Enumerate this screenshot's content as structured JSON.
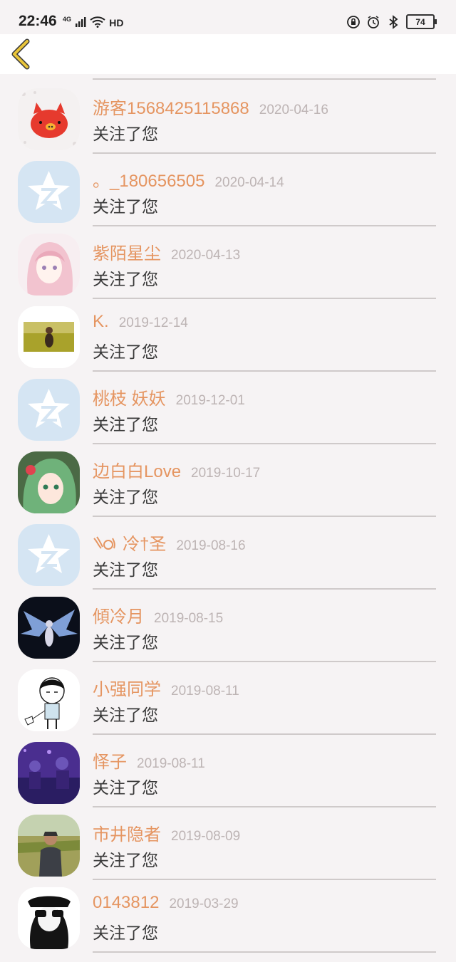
{
  "status": {
    "time": "22:46",
    "network": "4G",
    "hd": "HD",
    "battery": "74"
  },
  "header": {
    "back_icon": "chevron-left-icon",
    "accent_color": "#e9c53a"
  },
  "items": [
    {
      "name": "游客1568425115868",
      "date": "2020-04-16",
      "action": "关注了您",
      "avatar": "red-pig"
    },
    {
      "name": "。_180656505",
      "date": "2020-04-14",
      "action": "关注了您",
      "avatar": "qzone-star"
    },
    {
      "name": "紫陌星尘",
      "date": "2020-04-13",
      "action": "关注了您",
      "avatar": "pink-anime-girl"
    },
    {
      "name": "K.",
      "date": "2019-12-14",
      "action": "关注了您",
      "avatar": "field-photo"
    },
    {
      "name": "桃枝 妖妖",
      "date": "2019-12-01",
      "action": "关注了您",
      "avatar": "qzone-star"
    },
    {
      "name": "边白白Love",
      "date": "2019-10-17",
      "action": "关注了您",
      "avatar": "green-hair-anime"
    },
    {
      "name": "冷†圣",
      "date": "2019-08-16",
      "action": "关注了您",
      "avatar": "qzone-star",
      "prefix_icon": "wings-icon"
    },
    {
      "name": "傾冷月",
      "date": "2019-08-15",
      "action": "关注了您",
      "avatar": "dark-wings"
    },
    {
      "name": "小强同学",
      "date": "2019-08-11",
      "action": "关注了您",
      "avatar": "cartoon-boy"
    },
    {
      "name": "怿子",
      "date": "2019-08-11",
      "action": "关注了您",
      "avatar": "purple-concert"
    },
    {
      "name": "市井隐者",
      "date": "2019-08-09",
      "action": "关注了您",
      "avatar": "man-in-field"
    },
    {
      "name": "0143812",
      "date": "2019-03-29",
      "action": "关注了您",
      "avatar": "sunglasses-man"
    }
  ]
}
